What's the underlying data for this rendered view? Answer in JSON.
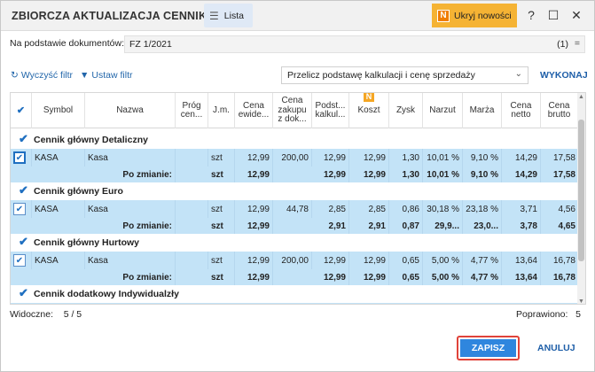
{
  "window": {
    "title": "ZBIORCZA AKTUALIZACJA CENNIKÓW",
    "list_button": "Lista",
    "news_badge": "N",
    "news_button": "Ukryj nowości",
    "help": "?",
    "maximize": "☐",
    "close": "✕"
  },
  "document": {
    "label": "Na podstawie dokumentów:",
    "value": "FZ 1/2021",
    "count": "(1)",
    "clear": "="
  },
  "filters": {
    "clear_filter": "Wyczyść filtr",
    "set_filter": "Ustaw filtr",
    "recalc_option": "Przelicz podstawę kalkulacji i cenę sprzedaży",
    "run": "WYKONAJ"
  },
  "columns": {
    "symbol": "Symbol",
    "nazwa": "Nazwa",
    "prog1": "Próg",
    "prog2": "cen...",
    "jm": "J.m.",
    "cena_ew1": "Cena",
    "cena_ew2": "ewide...",
    "cena_zak1": "Cena",
    "cena_zak2": "zakupu",
    "cena_zak3": "z dok...",
    "podst1": "Podst...",
    "podst2": "kalkul...",
    "koszt_badge": "N",
    "koszt": "Koszt",
    "zysk": "Zysk",
    "narzut": "Narzut",
    "marza": "Marża",
    "netto1": "Cena",
    "netto2": "netto",
    "brutto1": "Cena",
    "brutto2": "brutto"
  },
  "groups": [
    {
      "title": "Cennik  główny  Detaliczny",
      "item": {
        "symbol": "KASA",
        "nazwa": "Kasa",
        "jm": "szt",
        "cena_ew": "12,99",
        "cena_zak": "200,00",
        "podst": "12,99",
        "koszt": "12,99",
        "zysk": "1,30",
        "narzut": "10,01 %",
        "marza": "9,10 %",
        "netto": "14,29",
        "brutto": "17,58"
      },
      "after": {
        "label": "Po zmianie:",
        "jm": "szt",
        "cena_ew": "12,99",
        "podst": "12,99",
        "koszt": "12,99",
        "zysk": "1,30",
        "narzut": "10,01 %",
        "marza": "9,10 %",
        "netto": "14,29",
        "brutto": "17,58"
      }
    },
    {
      "title": "Cennik  główny  Euro",
      "item": {
        "symbol": "KASA",
        "nazwa": "Kasa",
        "jm": "szt",
        "cena_ew": "12,99",
        "cena_zak": "44,78",
        "podst": "2,85",
        "koszt": "2,85",
        "zysk": "0,86",
        "narzut": "30,18 %",
        "marza": "23,18 %",
        "netto": "3,71",
        "brutto": "4,56"
      },
      "after": {
        "label": "Po zmianie:",
        "jm": "szt",
        "cena_ew": "12,99",
        "podst": "2,91",
        "koszt": "2,91",
        "zysk": "0,87",
        "narzut": "29,9...",
        "marza": "23,0...",
        "netto": "3,78",
        "brutto": "4,65"
      }
    },
    {
      "title": "Cennik  główny  Hurtowy",
      "item": {
        "symbol": "KASA",
        "nazwa": "Kasa",
        "jm": "szt",
        "cena_ew": "12,99",
        "cena_zak": "200,00",
        "podst": "12,99",
        "koszt": "12,99",
        "zysk": "0,65",
        "narzut": "5,00 %",
        "marza": "4,77 %",
        "netto": "13,64",
        "brutto": "16,78"
      },
      "after": {
        "label": "Po zmianie:",
        "jm": "szt",
        "cena_ew": "12,99",
        "podst": "12,99",
        "koszt": "12,99",
        "zysk": "0,65",
        "narzut": "5,00 %",
        "marza": "4,77 %",
        "netto": "13,64",
        "brutto": "16,78"
      }
    },
    {
      "title": "Cennik  dodatkowy  Indywidualzły"
    }
  ],
  "status": {
    "visible_label": "Widoczne:",
    "visible_value": "5 / 5",
    "fixed_label": "Poprawiono:",
    "fixed_value": "5"
  },
  "actions": {
    "save": "ZAPISZ",
    "cancel": "ANULUJ"
  }
}
